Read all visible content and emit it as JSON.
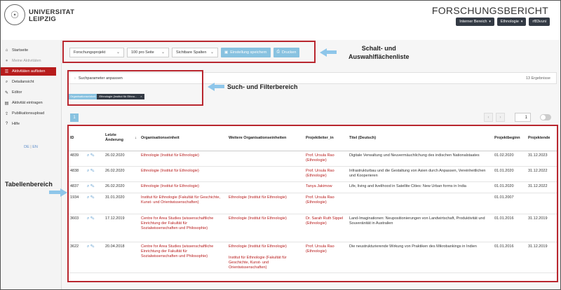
{
  "header": {
    "university_line1": "UNIVERSITAT",
    "university_line2": "LEIPZIG",
    "app_title": "FORSCHUNGSBERICHT",
    "buttons": [
      {
        "label": "Interner Bereich"
      },
      {
        "label": "Ethnologie"
      },
      {
        "label": "rf83vuni"
      }
    ]
  },
  "sidebar": {
    "items": [
      {
        "label": "Startseite",
        "icon": "home-icon"
      },
      {
        "label": "Meine Aktivitäten",
        "icon": "user-icon"
      },
      {
        "label": "Aktivitäten auflisten",
        "icon": "list-icon"
      },
      {
        "label": "Detailansicht",
        "icon": "search-icon"
      },
      {
        "label": "Editor",
        "icon": "edit-icon"
      },
      {
        "label": "Aktivität eintragen",
        "icon": "document-icon"
      },
      {
        "label": "Publikationsupload",
        "icon": "upload-icon"
      },
      {
        "label": "Hilfe",
        "icon": "help-icon"
      }
    ],
    "lang_de": "DE",
    "lang_sep": "|",
    "lang_en": "EN"
  },
  "toolbar": {
    "select_type": "Forschungsprojekt",
    "select_per_page": "100 pro Seite",
    "select_columns": "Sichtbare Spalten",
    "save_label": "Einstellung speichern",
    "print_label": "Drucken"
  },
  "callouts": {
    "toolbar_line1": "Schalt- und",
    "toolbar_line2": "Auswahlflächenliste",
    "search": "Such- und Filterbereich",
    "table": "Tabellenbereich"
  },
  "search": {
    "label": "Suchparameter anpassen",
    "results": "13 Ergebnisse",
    "filter_label": "Organisationseinheit",
    "filter_value": "Ethnologie (Institut für Ethno...",
    "filter_remove": "×"
  },
  "pagination": {
    "current_page": "1",
    "prev": "‹",
    "next": "›",
    "page_input": "1"
  },
  "table": {
    "headers": [
      "ID",
      "",
      "Letzte Änderung",
      "Organisationseinheit",
      "Weitere Organisationseinheiten",
      "Projektleiter_in",
      "Titel (Deutsch)",
      "Projektbeginn",
      "Projektende"
    ],
    "rows": [
      {
        "id": "4839",
        "date": "26.02.2020",
        "org": "Ethnologie (Institut für Ethnologie)",
        "further": "",
        "further2": "",
        "leader": "Prof. Ursula Rao (Ethnologie)",
        "title": "Digitale Verwaltung und Neuvermäuchlichung des indischen Nationalstaates",
        "start": "01.02.2020",
        "end": "31.12.2023"
      },
      {
        "id": "4838",
        "date": "26.02.2020",
        "org": "Ethnologie (Institut für Ethnologie)",
        "further": "",
        "further2": "",
        "leader": "Prof. Ursula Rao (Ethnologie)",
        "title": "Infrastrukturbau und die Gestaltung von Asien durch Anpassen, Vereinheitlichen und Kooperieren",
        "start": "01.01.2020",
        "end": "31.12.2022"
      },
      {
        "id": "4837",
        "date": "26.02.2020",
        "org": "Ethnologie (Institut für Ethnologie)",
        "further": "",
        "further2": "",
        "leader": "Tanya Jakimow",
        "title": "Life, living and livelihood in Satellite Cities: New Urban forms in India",
        "start": "01.01.2020",
        "end": "31.12.2022"
      },
      {
        "id": "1934",
        "date": "31.01.2020",
        "org": "Institut für Ethnologie (Fakultät für Geschichte, Kunst- und Orientwissenschaften)",
        "further": "Ethnologie (Institut für Ethnologie)",
        "further2": "",
        "leader": "Prof. Ursula Rao (Ethnologie)",
        "title": "",
        "start": "01.01.2007",
        "end": ""
      },
      {
        "id": "3603",
        "date": "17.12.2019",
        "org": "Centre for Area Studies (wissenschaftliche Einrichtung der Fakultät für Sozialwissenschaften und Philosophie)",
        "further": "Ethnologie (Institut für Ethnologie)",
        "further2": "",
        "leader": "Dr. Sarah Ruth Sippel (Ethnologie)",
        "title": "Land-Imaginationen: Neupositionierungen von Landwirtschaft, Produktivität und Souveränität in Australien",
        "start": "01.01.2016",
        "end": "31.12.2019"
      },
      {
        "id": "3622",
        "date": "20.04.2018",
        "org": "Centre for Area Studies (wissenschaftliche Einrichtung der Fakultät für Sozialwissenschaften und Philosophie)",
        "further": "Ethnologie (Institut für Ethnologie)",
        "further2": "Institut für Ethnologie (Fakultät für Geschichte, Kunst- und Orientwissenschaften)",
        "leader": "Prof. Ursula Rao (Ethnologie)",
        "title": "Die neustrukturierende Wirkung von Praktiken des Mikrobankings in Indien",
        "start": "01.01.2016",
        "end": "31.12.2019"
      }
    ]
  }
}
